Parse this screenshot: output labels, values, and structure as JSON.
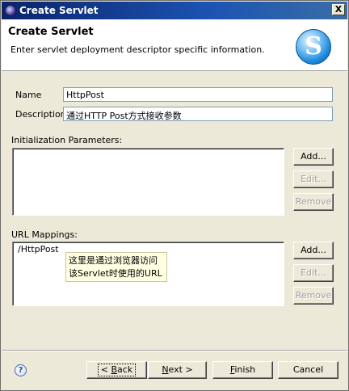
{
  "window": {
    "title": "Create Servlet",
    "close_label": "X"
  },
  "banner": {
    "title": "Create Servlet",
    "description": "Enter servlet deployment descriptor specific information.",
    "logo_letter": "S"
  },
  "form": {
    "name_label": "Name",
    "name_value": "HttpPost",
    "description_label": "Description",
    "description_value": "通过HTTP Post方式接收参数"
  },
  "init_params": {
    "label": "Initialization Parameters:",
    "buttons": {
      "add": "Add...",
      "edit": "Edit...",
      "remove": "Remove"
    }
  },
  "url_mappings": {
    "label": "URL Mappings:",
    "items": [
      "/HttpPost"
    ],
    "tooltip_line1": "这里是通过浏览器访问",
    "tooltip_line2": "该Servlet时使用的URL",
    "buttons": {
      "add": "Add...",
      "edit": "Edit...",
      "remove": "Remove"
    }
  },
  "footer": {
    "help_icon": "?",
    "back_mnemonic": "B",
    "back_prefix": "< ",
    "back_rest": "ack",
    "next_mnemonic": "N",
    "next_rest": "ext >",
    "finish_mnemonic": "F",
    "finish_rest": "inish",
    "cancel_label": "Cancel"
  }
}
